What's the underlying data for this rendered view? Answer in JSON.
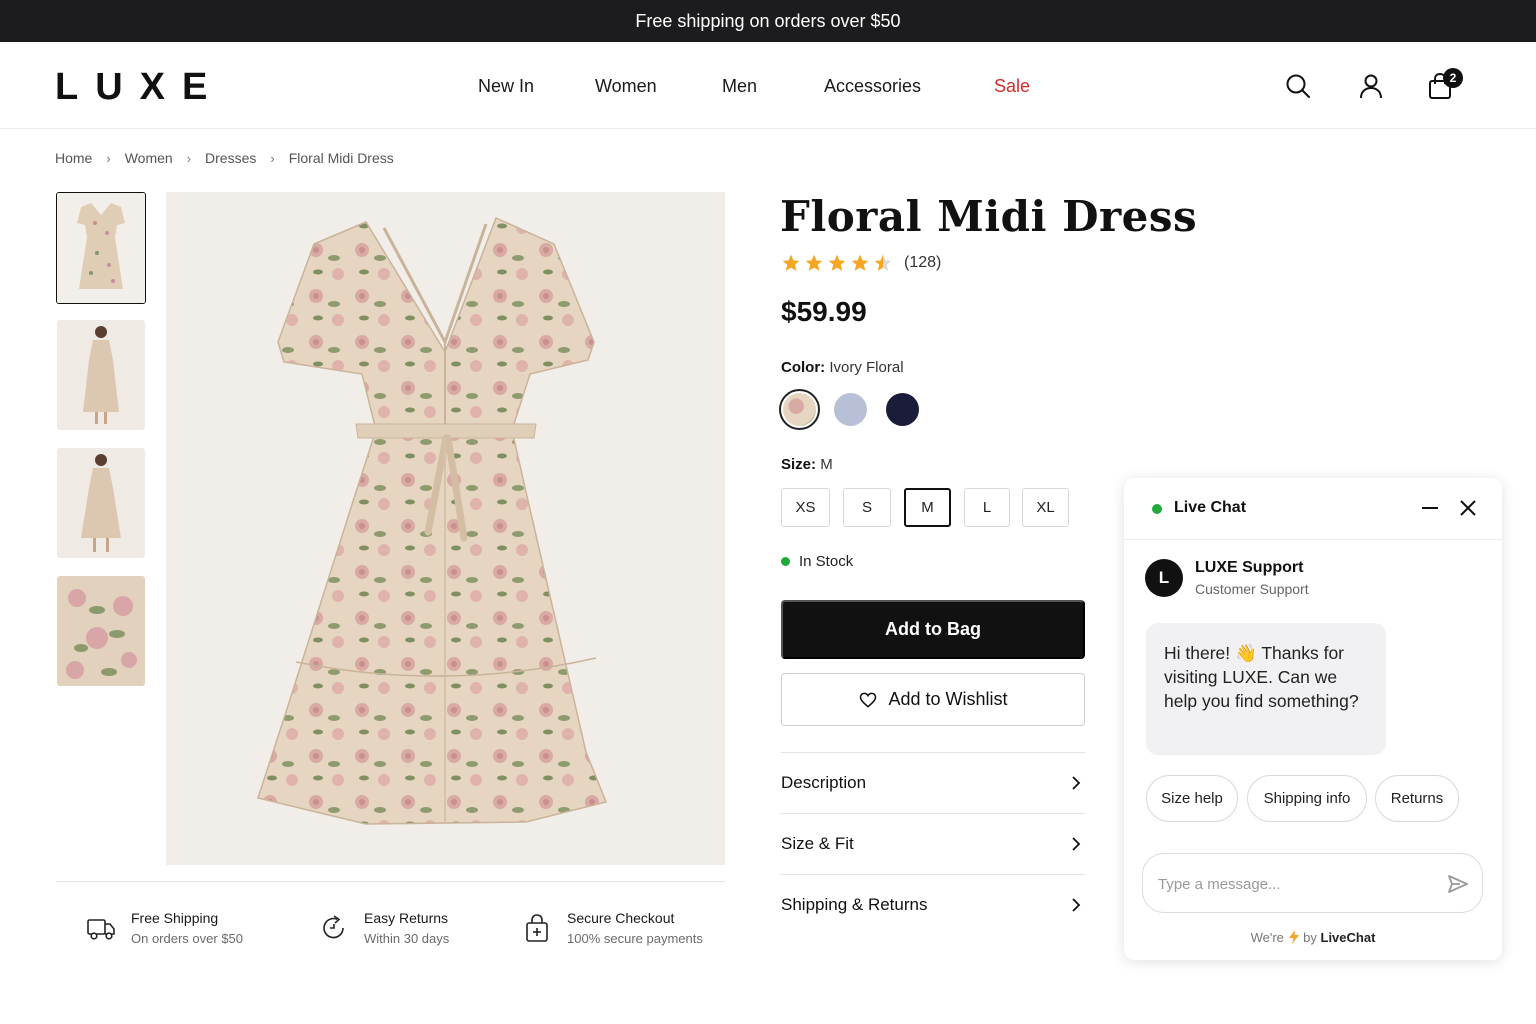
{
  "announcement": "Free shipping on orders over $50",
  "brand": "LUXE",
  "nav": [
    "New In",
    "Women",
    "Men",
    "Accessories",
    "Sale"
  ],
  "cart_count": "2",
  "breadcrumb": [
    "Home",
    "Women",
    "Dresses",
    "Floral Midi Dress"
  ],
  "product": {
    "title": "Floral Midi Dress",
    "rating": 4.5,
    "review_count": "(128)",
    "price": "$59.99",
    "color_label": "Color:",
    "color_value": "Ivory Floral",
    "size_label": "Size:",
    "size_value": "M",
    "sizes": [
      "XS",
      "S",
      "M",
      "L",
      "XL"
    ],
    "selected_size": "M",
    "stock": "In Stock",
    "add_to_bag": "Add to Bag",
    "add_to_wishlist": "Add to Wishlist",
    "accordions": [
      "Description",
      "Size & Fit",
      "Shipping & Returns"
    ]
  },
  "features": [
    {
      "title": "Free Shipping",
      "sub": "On orders over $50",
      "icon": "truck-icon"
    },
    {
      "title": "Easy Returns",
      "sub": "Within 30 days",
      "icon": "return-icon"
    },
    {
      "title": "Secure Checkout",
      "sub": "100% secure payments",
      "icon": "lock-bag-icon"
    }
  ],
  "chat": {
    "title": "Live Chat",
    "agent_initial": "L",
    "agent_name": "LUXE Support",
    "agent_role": "Customer Support",
    "message": "Hi there! 👋 Thanks for visiting LUXE. Can we help you find something?",
    "chips": [
      "Size help",
      "Shipping info",
      "Returns"
    ],
    "input_placeholder": "Type a message...",
    "powered_prefix": "We're",
    "powered_suffix": "by",
    "powered_brand": "LiveChat"
  },
  "colors": {
    "accent": "#111111",
    "sale": "#d42a2a",
    "online": "#1faa3a",
    "star": "#f5a623"
  }
}
